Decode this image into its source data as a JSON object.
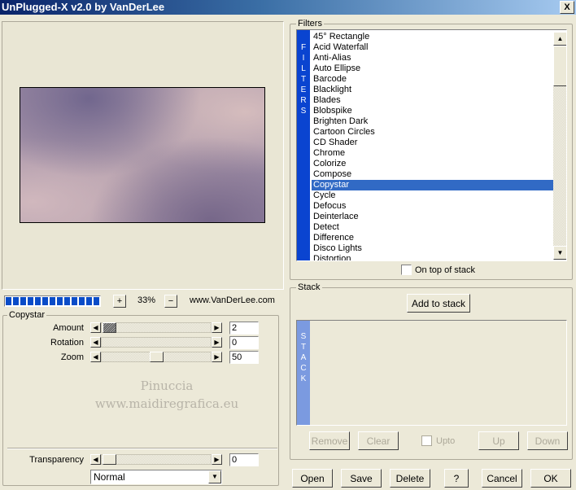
{
  "window": {
    "title": "UnPlugged-X v2.0 by VanDerLee",
    "close_label": "X"
  },
  "zoom": {
    "progress": 1.0,
    "plus_label": "+",
    "minus_label": "−",
    "value": "33%",
    "website": "www.VanDerLee.com"
  },
  "params": {
    "title": "Copystar",
    "amount": {
      "label": "Amount",
      "value": "2"
    },
    "rotation": {
      "label": "Rotation",
      "value": "0"
    },
    "zoom": {
      "label": "Zoom",
      "value": "50"
    },
    "watermark_line1": "Pinuccia",
    "watermark_line2": "www.maidiregrafica.eu"
  },
  "transparency": {
    "label": "Transparency",
    "value": "0",
    "blend_mode": "Normal"
  },
  "filters": {
    "title": "Filters",
    "strip_letters": [
      "F",
      "I",
      "L",
      "T",
      "E",
      "R",
      "S"
    ],
    "items": [
      "45° Rectangle",
      "Acid Waterfall",
      "Anti-Alias",
      "Auto Ellipse",
      "Barcode",
      "Blacklight",
      "Blades",
      "Blobspike",
      "Brighten Dark",
      "Cartoon Circles",
      "CD Shader",
      "Chrome",
      "Colorize",
      "Compose",
      "Copystar",
      "Cycle",
      "Defocus",
      "Deinterlace",
      "Detect",
      "Difference",
      "Disco Lights",
      "Distortion"
    ],
    "selected": "Copystar",
    "on_top_label": "On top of stack"
  },
  "stack": {
    "title": "Stack",
    "add_label": "Add to stack",
    "strip_letters": [
      "S",
      "T",
      "A",
      "C",
      "K"
    ],
    "remove_label": "Remove",
    "clear_label": "Clear",
    "upto_label": "Upto",
    "up_label": "Up",
    "down_label": "Down"
  },
  "footer": {
    "open": "Open",
    "save": "Save",
    "delete": "Delete",
    "help": "?",
    "cancel": "Cancel",
    "ok": "OK"
  },
  "colors": {
    "accent": "#0a44d0",
    "selection": "#316ac5",
    "face": "#ece9d8"
  }
}
